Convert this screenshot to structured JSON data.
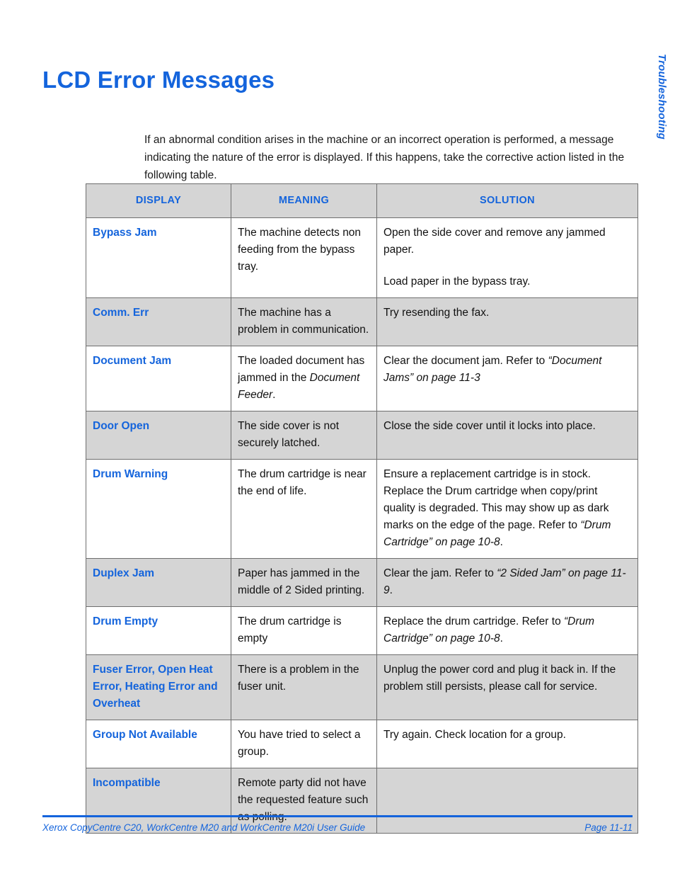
{
  "page_title": "LCD Error Messages",
  "side_tab": "Troubleshooting",
  "intro": "If an abnormal condition arises in the machine or an incorrect operation is performed, a message indicating the nature of the error is displayed. If this happens, take the corrective action listed in the following table.",
  "colors": {
    "accent_blue": "#1464dc",
    "row_shade": "#d5d5d5",
    "border": "#6e6e6e",
    "text": "#111111"
  },
  "table": {
    "headers": [
      "DISPLAY",
      "MEANING",
      "SOLUTION"
    ],
    "rows": [
      {
        "display": "Bypass Jam",
        "meaning": [
          {
            "text": "The machine detects non feeding from the bypass tray.",
            "italic": false
          }
        ],
        "solution": [
          {
            "text": "Open the side cover and remove any jammed paper.",
            "italic": false
          },
          {
            "text": "Load paper in the bypass tray.",
            "italic": false
          }
        ]
      },
      {
        "display": "Comm. Err",
        "meaning": [
          {
            "text": "The machine has a problem in communication.",
            "italic": false
          }
        ],
        "solution": [
          {
            "text": "Try resending the fax.",
            "italic": false
          }
        ]
      },
      {
        "display": "Document Jam",
        "meaning": [
          {
            "text": "The loaded document has jammed in the ",
            "italic": false
          },
          {
            "text": "Document Feeder",
            "italic": true
          },
          {
            "text": ".",
            "italic": false
          }
        ],
        "solution": [
          {
            "text": "Clear the document jam. Refer to ",
            "italic": false
          },
          {
            "text": "“Document Jams” on page 11-3",
            "italic": true
          }
        ]
      },
      {
        "display": "Door Open",
        "meaning": [
          {
            "text": "The side cover is not securely latched.",
            "italic": false
          }
        ],
        "solution": [
          {
            "text": "Close the side cover until it locks into place.",
            "italic": false
          }
        ]
      },
      {
        "display": "Drum Warning",
        "meaning": [
          {
            "text": "The drum cartridge is near the end of life.",
            "italic": false
          }
        ],
        "solution": [
          {
            "text": "Ensure a replacement cartridge is in stock. Replace the Drum cartridge when copy/print quality is degraded. This may show up as dark marks on the edge of the page. Refer to ",
            "italic": false
          },
          {
            "text": "“Drum Cartridge” on page 10-8",
            "italic": true
          },
          {
            "text": ".",
            "italic": false
          }
        ]
      },
      {
        "display": "Duplex Jam",
        "meaning": [
          {
            "text": "Paper has jammed in the middle of 2 Sided printing.",
            "italic": false
          }
        ],
        "solution": [
          {
            "text": "Clear the jam. Refer to ",
            "italic": false
          },
          {
            "text": "“2 Sided Jam” on page 11-9",
            "italic": true
          },
          {
            "text": ".",
            "italic": false
          }
        ]
      },
      {
        "display": "Drum Empty",
        "meaning": [
          {
            "text": "The drum cartridge is empty",
            "italic": false
          }
        ],
        "solution": [
          {
            "text": "Replace the drum cartridge. Refer to ",
            "italic": false
          },
          {
            "text": "“Drum Cartridge” on page 10-8",
            "italic": true
          },
          {
            "text": ".",
            "italic": false
          }
        ]
      },
      {
        "display": "Fuser Error, Open Heat Error, Heating Error and Overheat",
        "meaning": [
          {
            "text": "There is a problem in the fuser unit.",
            "italic": false
          }
        ],
        "solution": [
          {
            "text": "Unplug the power cord and plug it back in. If the problem still persists, please call for service.",
            "italic": false
          }
        ]
      },
      {
        "display": "Group Not Available",
        "meaning": [
          {
            "text": "You have tried to select a group.",
            "italic": false
          }
        ],
        "solution": [
          {
            "text": "Try again. Check location for a group.",
            "italic": false
          }
        ]
      },
      {
        "display": "Incompatible",
        "meaning": [
          {
            "text": "Remote party did not have the requested feature such as polling.",
            "italic": false
          }
        ],
        "solution": []
      }
    ]
  },
  "footer": {
    "left": "Xerox CopyCentre C20, WorkCentre M20 and WorkCentre M20i User Guide",
    "right": "Page 11-11"
  }
}
